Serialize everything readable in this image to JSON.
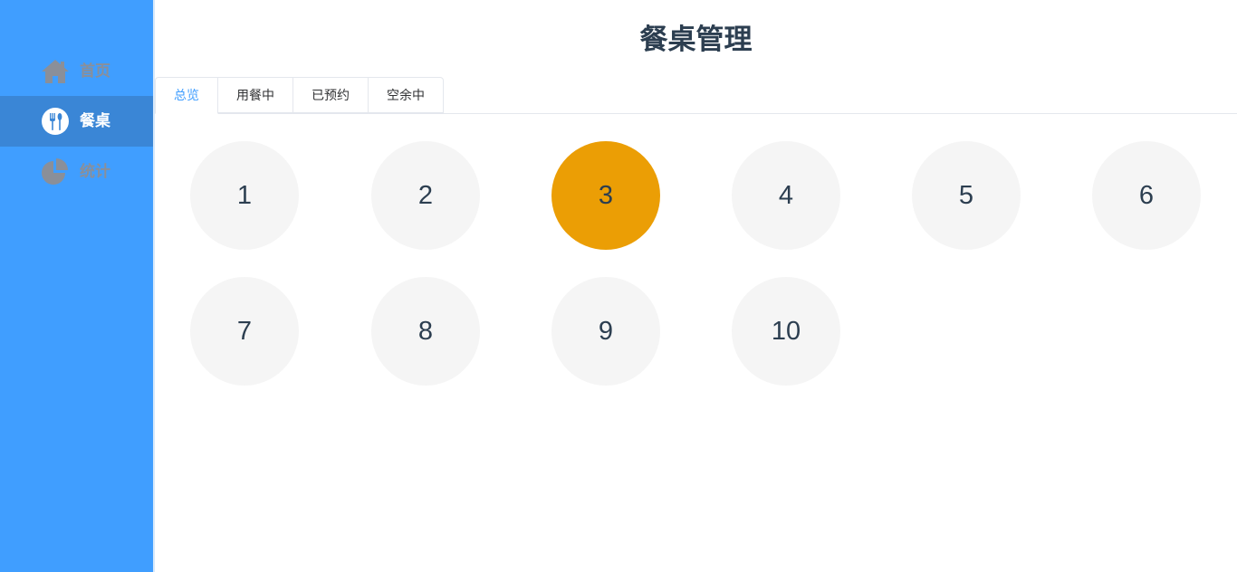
{
  "sidebar": {
    "items": [
      {
        "label": "首页",
        "icon": "home-icon",
        "active": false
      },
      {
        "label": "餐桌",
        "icon": "utensils-icon",
        "active": true
      },
      {
        "label": "统计",
        "icon": "pie-chart-icon",
        "active": false
      }
    ]
  },
  "header": {
    "title": "餐桌管理"
  },
  "tabs": [
    {
      "label": "总览",
      "active": true
    },
    {
      "label": "用餐中",
      "active": false
    },
    {
      "label": "已预约",
      "active": false
    },
    {
      "label": "空余中",
      "active": false
    }
  ],
  "tables": [
    {
      "number": "1",
      "status": "free"
    },
    {
      "number": "2",
      "status": "free"
    },
    {
      "number": "3",
      "status": "busy"
    },
    {
      "number": "4",
      "status": "free"
    },
    {
      "number": "5",
      "status": "free"
    },
    {
      "number": "6",
      "status": "free"
    },
    {
      "number": "7",
      "status": "free"
    },
    {
      "number": "8",
      "status": "free"
    },
    {
      "number": "9",
      "status": "free"
    },
    {
      "number": "10",
      "status": "free"
    }
  ],
  "colors": {
    "sidebar_bg": "#409eff",
    "sidebar_active_bg": "#3a86d6",
    "accent": "#409eff",
    "busy": "#eb9e05",
    "free": "#f5f5f5",
    "text": "#2c3e50"
  }
}
